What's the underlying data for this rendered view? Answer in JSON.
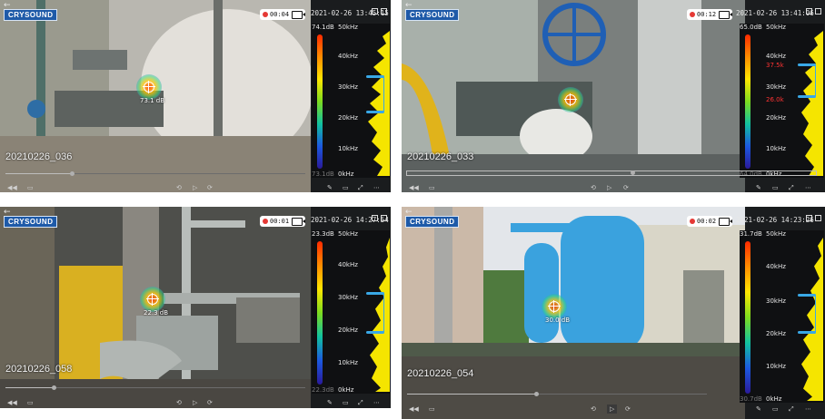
{
  "common": {
    "logo": "CRYSOUND",
    "back_glyph": "←",
    "freq_khz": [
      "50kHz",
      "40kHz",
      "30kHz",
      "20kHz",
      "10kHz",
      "0kHz"
    ]
  },
  "panels": [
    {
      "id": "p1",
      "label": "20210226_036",
      "timer": "00:04",
      "timestamp": "2021-02-26 13:45:15",
      "db_top": "74.1dB",
      "db_bottom": "73.1dB",
      "reading": "73.1 dB",
      "marker_pos": "upper-left",
      "progress": 0.22,
      "colors": {
        "wall": "#c8c5bc",
        "pipe": "#6b6e6a",
        "floor": "#8a8376"
      }
    },
    {
      "id": "p2",
      "label": "20210226_033",
      "timer": "00:12",
      "timestamp": "2021-02-26 13:41:06",
      "db_top": "65.0dB",
      "db_bottom": "64.0dB",
      "reading": "",
      "red_marks": [
        "37.5k",
        "26.0k"
      ],
      "progress": 0.55,
      "colors": {
        "wall": "#9aa19d",
        "pipe": "#e0b31b",
        "floor": "#5c6160"
      }
    },
    {
      "id": "p3",
      "label": "20210226_058",
      "timer": "00:01",
      "timestamp": "2021-02-26 14:27:54",
      "db_top": "23.3dB",
      "db_bottom": "22.3dB",
      "reading": "22.3 dB",
      "progress": 0.16,
      "colors": {
        "wall": "#595a56",
        "pipe": "#b8bdba",
        "floor": "#4a4742"
      }
    },
    {
      "id": "p4",
      "label": "20210226_054",
      "timer": "00:02",
      "timestamp": "2021-02-26 14:23:26",
      "db_top": "31.7dB",
      "db_bottom": "30.7dB",
      "reading": "30.0 dB",
      "progress": 0.43,
      "colors": {
        "wall": "#d9d6c8",
        "pipe": "#3aa2de",
        "floor": "#4f5a4a"
      }
    }
  ]
}
